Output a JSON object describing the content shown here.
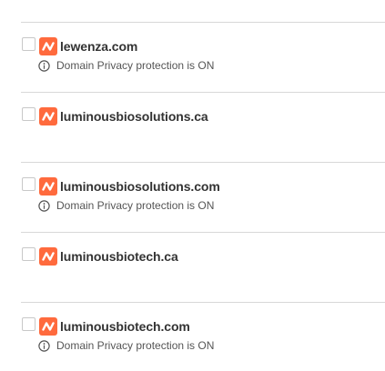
{
  "colors": {
    "brand_accent": "#ff6a3d",
    "divider": "#d8d8d8",
    "domain_text": "#333333",
    "privacy_text": "#555555"
  },
  "domains": [
    {
      "name": "lewenza.com",
      "checked": false,
      "brand_icon": "domain-brand-icon",
      "privacy_note": "Domain Privacy protection is ON",
      "privacy_icon": "info-icon"
    },
    {
      "name": "luminousbiosolutions.ca",
      "checked": false,
      "brand_icon": "domain-brand-icon"
    },
    {
      "name": "luminousbiosolutions.com",
      "checked": false,
      "brand_icon": "domain-brand-icon",
      "privacy_note": "Domain Privacy protection is ON",
      "privacy_icon": "info-icon"
    },
    {
      "name": "luminousbiotech.ca",
      "checked": false,
      "brand_icon": "domain-brand-icon"
    },
    {
      "name": "luminousbiotech.com",
      "checked": false,
      "brand_icon": "domain-brand-icon",
      "privacy_note": "Domain Privacy protection is ON",
      "privacy_icon": "info-icon"
    }
  ]
}
